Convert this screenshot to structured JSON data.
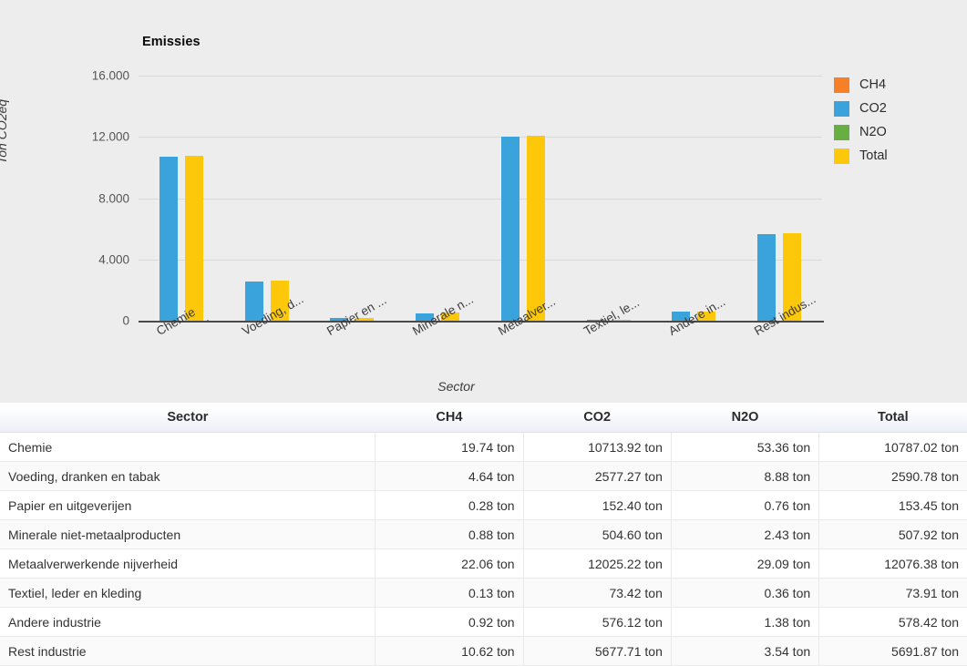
{
  "chart": {
    "title": "Emissies",
    "x_axis_title": "Sector",
    "y_axis_title": "Ton CO2eq"
  },
  "legend": {
    "items": [
      {
        "label": "CH4",
        "color": "#f58026"
      },
      {
        "label": "CO2",
        "color": "#3aa3db"
      },
      {
        "label": "N2O",
        "color": "#67ae43"
      },
      {
        "label": "Total",
        "color": "#fdc80a"
      }
    ]
  },
  "table": {
    "headers": [
      "Sector",
      "CH4",
      "CO2",
      "N2O",
      "Total"
    ],
    "rows": [
      {
        "sector": "Chemie",
        "ch4": "19.74 ton",
        "co2": "10713.92 ton",
        "n2o": "53.36 ton",
        "total": "10787.02 ton"
      },
      {
        "sector": "Voeding, dranken en tabak",
        "ch4": "4.64 ton",
        "co2": "2577.27 ton",
        "n2o": "8.88 ton",
        "total": "2590.78 ton"
      },
      {
        "sector": "Papier en uitgeverijen",
        "ch4": "0.28 ton",
        "co2": "152.40 ton",
        "n2o": "0.76 ton",
        "total": "153.45 ton"
      },
      {
        "sector": "Minerale niet-metaalproducten",
        "ch4": "0.88 ton",
        "co2": "504.60 ton",
        "n2o": "2.43 ton",
        "total": "507.92 ton"
      },
      {
        "sector": "Metaalverwerkende nijverheid",
        "ch4": "22.06 ton",
        "co2": "12025.22 ton",
        "n2o": "29.09 ton",
        "total": "12076.38 ton"
      },
      {
        "sector": "Textiel, leder en kleding",
        "ch4": "0.13 ton",
        "co2": "73.42 ton",
        "n2o": "0.36 ton",
        "total": "73.91 ton"
      },
      {
        "sector": "Andere industrie",
        "ch4": "0.92 ton",
        "co2": "576.12 ton",
        "n2o": "1.38 ton",
        "total": "578.42 ton"
      },
      {
        "sector": "Rest industrie",
        "ch4": "10.62 ton",
        "co2": "5677.71 ton",
        "n2o": "3.54 ton",
        "total": "5691.87 ton"
      }
    ]
  },
  "chart_data": {
    "type": "bar",
    "title": "Emissies",
    "xlabel": "Sector",
    "ylabel": "Ton CO2eq",
    "ylim": [
      0,
      16000
    ],
    "yticks": [
      0,
      4000,
      8000,
      12000,
      16000
    ],
    "ytick_labels": [
      "0",
      "4.000",
      "8.000",
      "12.000",
      "16.000"
    ],
    "grid": true,
    "legend_position": "right",
    "categories": [
      "Chemie",
      "Voeding, dranken en tabak",
      "Papier en uitgeverijen",
      "Minerale niet-metaalproducten",
      "Metaalverwerkende nijverheid",
      "Textiel, leder en kleding",
      "Andere industrie",
      "Rest industrie"
    ],
    "category_tick_labels": [
      "Chemie",
      "Voeding, d...",
      "Papier en ...",
      "Minerale n...",
      "Metaalver...",
      "Textiel, le...",
      "Andere in...",
      "Rest indus..."
    ],
    "series": [
      {
        "name": "CH4",
        "color": "#f58026",
        "values": [
          19.74,
          4.64,
          0.28,
          0.88,
          22.06,
          0.13,
          0.92,
          10.62
        ]
      },
      {
        "name": "CO2",
        "color": "#3aa3db",
        "values": [
          10713.92,
          2577.27,
          152.4,
          504.6,
          12025.22,
          73.42,
          576.12,
          5677.71
        ]
      },
      {
        "name": "N2O",
        "color": "#67ae43",
        "values": [
          53.36,
          8.88,
          0.76,
          2.43,
          29.09,
          0.36,
          1.38,
          3.54
        ]
      },
      {
        "name": "Total",
        "color": "#fdc80a",
        "values": [
          10787.02,
          2590.78,
          153.45,
          507.92,
          12076.38,
          73.91,
          578.42,
          5691.87
        ]
      }
    ]
  }
}
